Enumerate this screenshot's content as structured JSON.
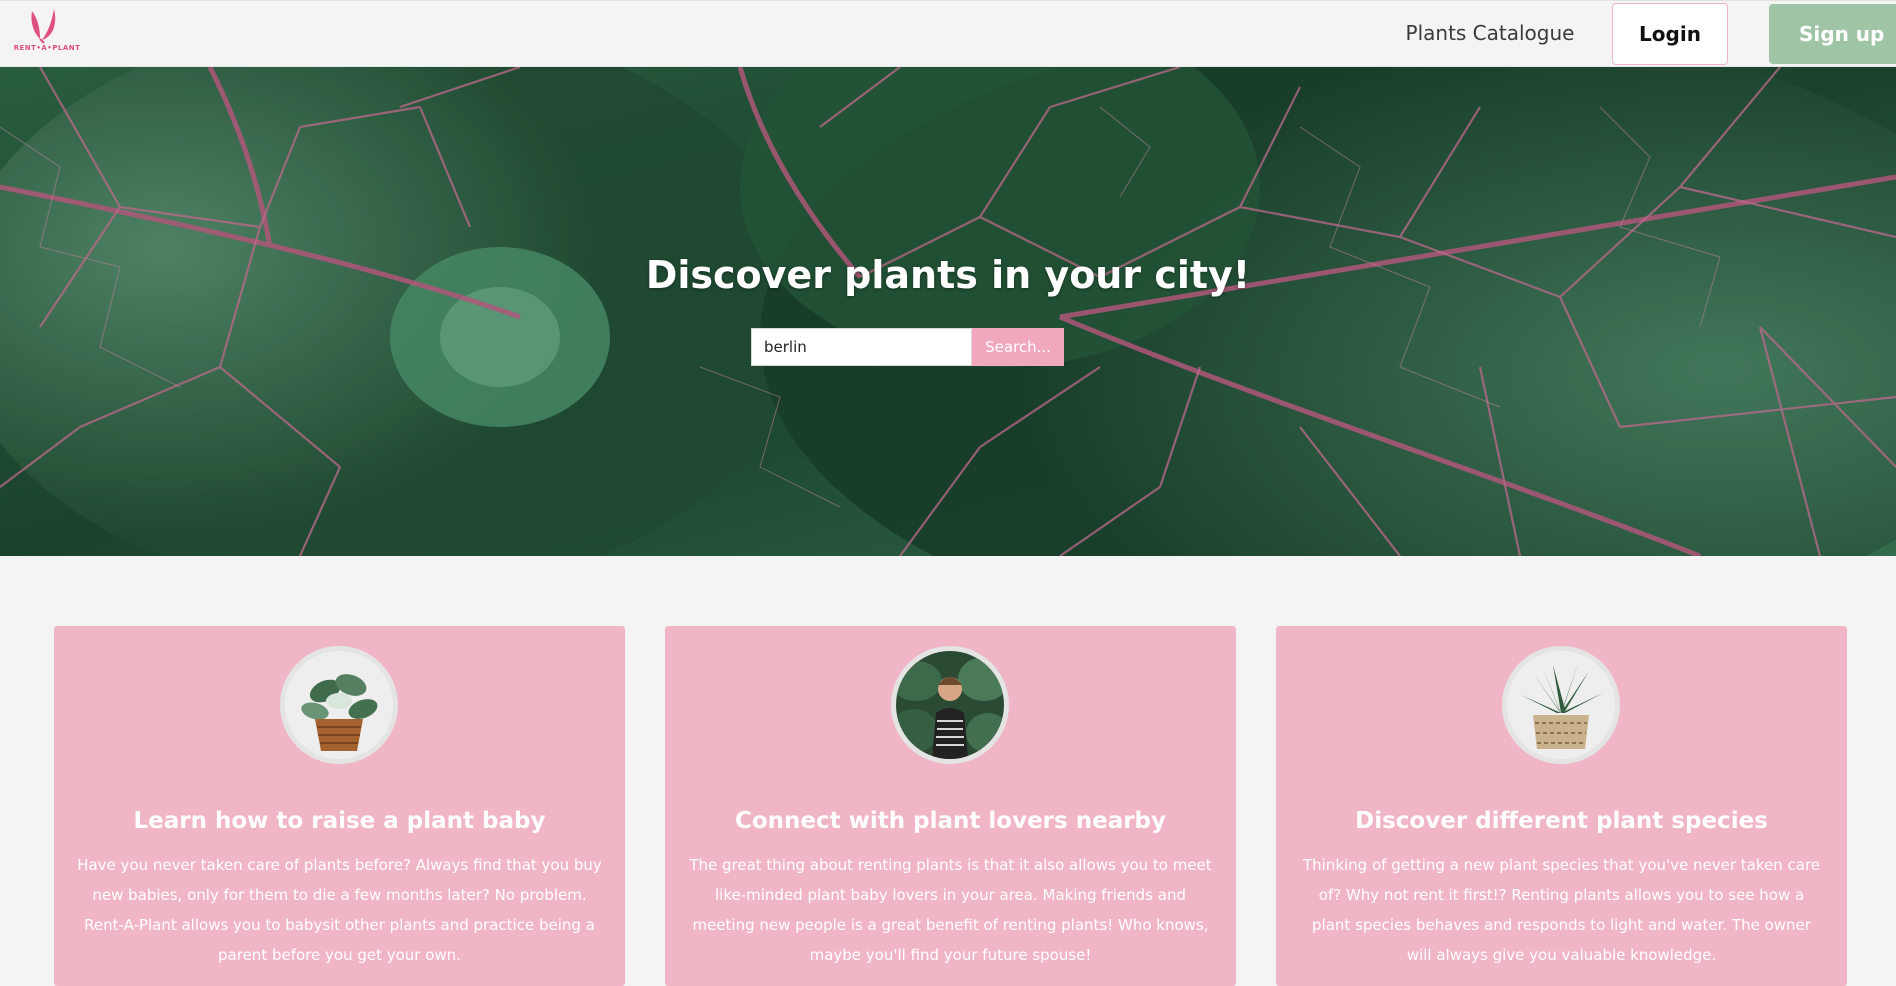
{
  "brand": {
    "logo_text": "RENT•A•PLANT",
    "accent_color": "#e0507e"
  },
  "nav": {
    "catalogue_label": "Plants Catalogue",
    "login_label": "Login",
    "signup_label": "Sign up",
    "signup_color": "#9fc5a6"
  },
  "hero": {
    "title": "Discover plants in your city!",
    "search_value": "berlin",
    "search_button_label": "Search..."
  },
  "cards": [
    {
      "title": "Learn how to raise a plant baby",
      "text": "Have you never taken care of plants before? Always find that you buy new babies, only for them to die a few months later? No problem. Rent-A-Plant allows you to babysit other plants and practice being a parent before you get your own.",
      "icon": "potted-plant-image"
    },
    {
      "title": "Connect with plant lovers nearby",
      "text": "The great thing about renting plants is that it also allows you to meet like-minded plant baby lovers in your area. Making friends and meeting new people is a great benefit of renting plants! Who knows, maybe you'll find your future spouse!",
      "icon": "person-image"
    },
    {
      "title": "Discover different plant species",
      "text": "Thinking of getting a new plant species that you've never taken care of? Why not rent it first!? Renting plants allows you to see how a plant species behaves and responds to light and water. The owner will always give you valuable knowledge.",
      "icon": "succulent-image"
    }
  ],
  "colors": {
    "card_background": "#f1b6c6",
    "search_button": "#f0a8bd",
    "page_background": "#f4f4f4"
  }
}
